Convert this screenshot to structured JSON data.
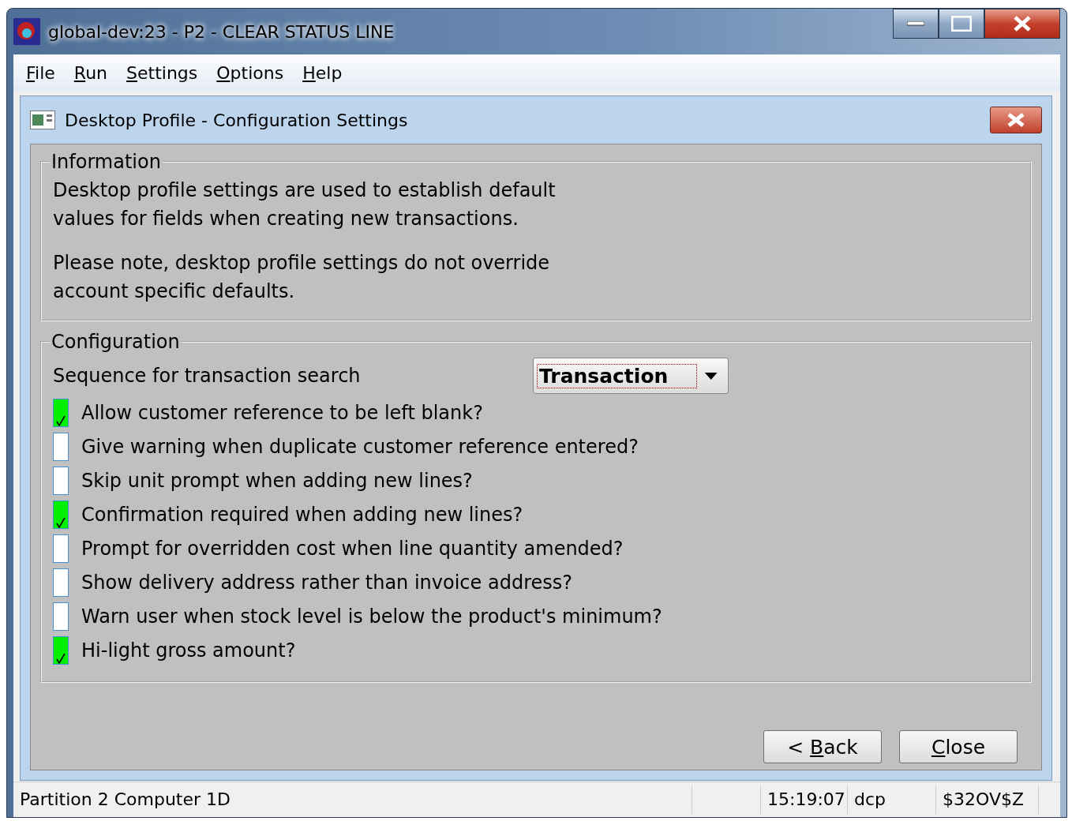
{
  "window": {
    "title": "global-dev:23 - P2 - CLEAR STATUS LINE"
  },
  "menu": [
    {
      "key": "F",
      "after": "ile"
    },
    {
      "key": "R",
      "after": "un"
    },
    {
      "key": "S",
      "after": "ettings"
    },
    {
      "key": "O",
      "after": "ptions"
    },
    {
      "key": "H",
      "after": "elp"
    }
  ],
  "dialog": {
    "title": "Desktop Profile - Configuration Settings",
    "information": {
      "legend": "Information",
      "paragraphs": [
        "Desktop profile settings are used to establish default\nvalues for fields when creating new transactions.",
        "Please note, desktop profile settings do not override\naccount specific defaults."
      ]
    },
    "configuration": {
      "legend": "Configuration",
      "sequence_label": "Sequence for transaction search",
      "sequence_value": "Transaction",
      "options": [
        {
          "label": "Allow customer reference to be left blank?",
          "checked": true
        },
        {
          "label": "Give warning when duplicate customer reference entered?",
          "checked": false
        },
        {
          "label": "Skip unit prompt when adding new lines?",
          "checked": false
        },
        {
          "label": "Confirmation required when adding new lines?",
          "checked": true
        },
        {
          "label": "Prompt for overridden cost when line quantity amended?",
          "checked": false
        },
        {
          "label": "Show delivery address rather than invoice address?",
          "checked": false
        },
        {
          "label": "Warn user when stock level is below the product's minimum?",
          "checked": false
        },
        {
          "label": "Hi-light gross amount?",
          "checked": true
        }
      ]
    },
    "buttons": [
      {
        "before": "< ",
        "key": "B",
        "after": "ack"
      },
      {
        "key": "C",
        "after": "lose"
      }
    ]
  },
  "status_bar": [
    "Partition 2 Computer 1D",
    "15:19:07",
    "dcp",
    "$32OV$Z"
  ]
}
